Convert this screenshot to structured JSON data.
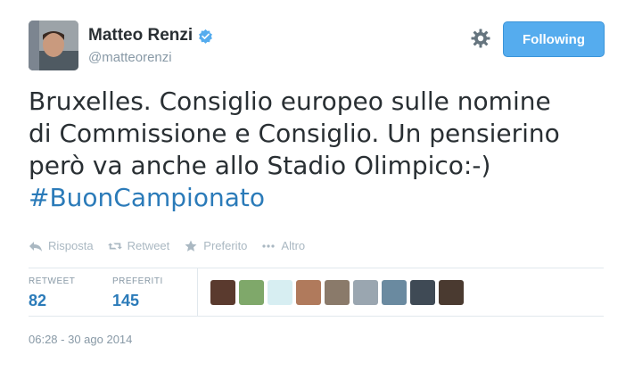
{
  "user": {
    "full_name": "Matteo Renzi",
    "handle": "@matteorenzi",
    "verified": true
  },
  "follow_button": {
    "label": "Following"
  },
  "tweet": {
    "lines": [
      "Bruxelles. Consiglio europeo sulle nomine",
      "di Commissione e Consiglio. Un pensierino",
      "però va anche allo Stadio Olimpico:-)"
    ],
    "hashtag": "#BuonCampionato"
  },
  "actions": {
    "reply": "Risposta",
    "retweet": "Retweet",
    "favorite": "Preferito",
    "more": "Altro"
  },
  "stats": {
    "retweet_label": "RETWEET",
    "retweet_count": "82",
    "favorites_label": "PREFERITI",
    "favorites_count": "145"
  },
  "favoriters": [
    {
      "color": "#5a3a2e"
    },
    {
      "color": "#7fa86a"
    },
    {
      "color": "#d7eef2"
    },
    {
      "color": "#b07a5c"
    },
    {
      "color": "#8a7a6a"
    },
    {
      "color": "#9aa6b0"
    },
    {
      "color": "#6a8aa0"
    },
    {
      "color": "#3f4a55"
    },
    {
      "color": "#4a3a30"
    }
  ],
  "timestamp": "06:28 - 30 ago 2014",
  "colors": {
    "accent": "#55acee",
    "link": "#2b7bb9",
    "muted": "#8899a6"
  }
}
